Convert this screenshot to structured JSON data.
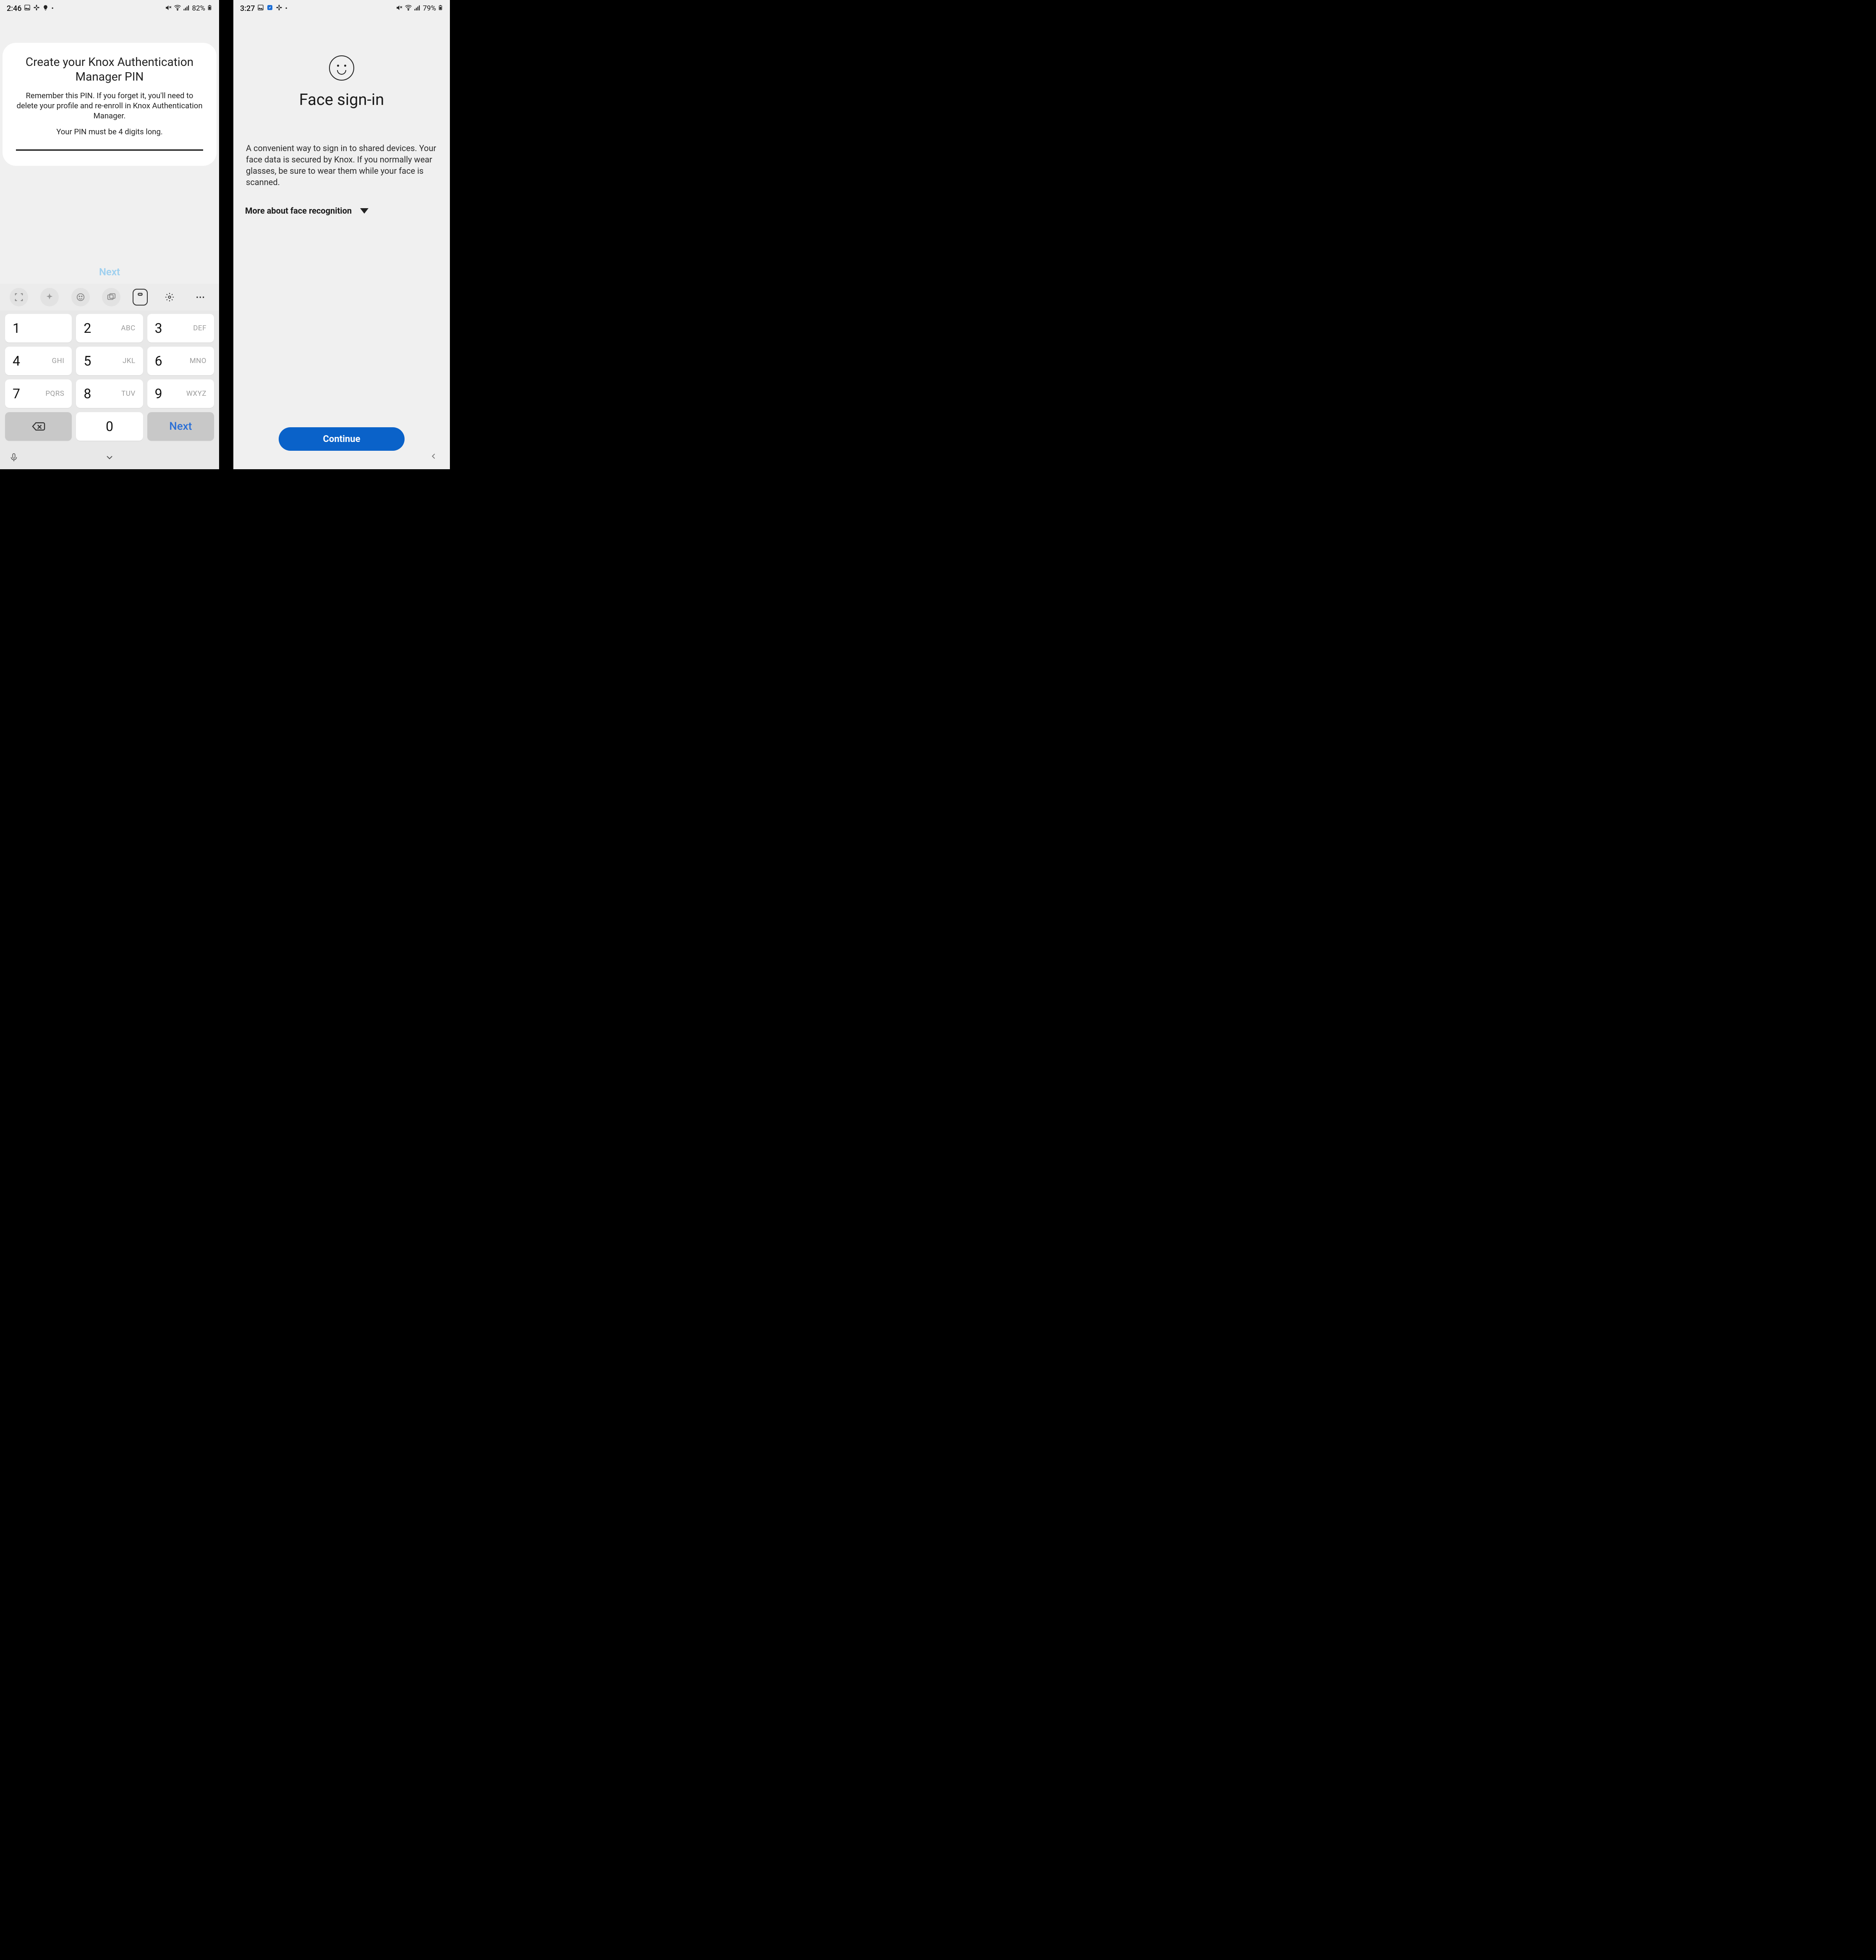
{
  "left": {
    "status": {
      "time": "2:46",
      "battery": "82%"
    },
    "title": "Create your Knox Authentication Manager PIN",
    "body1": "Remember this PIN. If you forget it, you'll need to delete your profile and re-enroll in Knox Authentication Manager.",
    "body2": "Your PIN must be 4 digits long.",
    "next_label": "Next",
    "keys": {
      "k1": "1",
      "k2": "2",
      "k3": "3",
      "k4": "4",
      "k5": "5",
      "k6": "6",
      "k7": "7",
      "k8": "8",
      "k9": "9",
      "k0": "0",
      "s2": "ABC",
      "s3": "DEF",
      "s4": "GHI",
      "s5": "JKL",
      "s6": "MNO",
      "s7": "PQRS",
      "s8": "TUV",
      "s9": "WXYZ",
      "next": "Next"
    }
  },
  "right": {
    "status": {
      "time": "3:27",
      "battery": "79%"
    },
    "title": "Face sign-in",
    "desc": "A convenient way to sign in to shared devices. Your face data is secured by Knox. If you normally wear glasses, be sure to wear them while your face is scanned.",
    "more": "More about face recognition",
    "continue": "Continue"
  }
}
